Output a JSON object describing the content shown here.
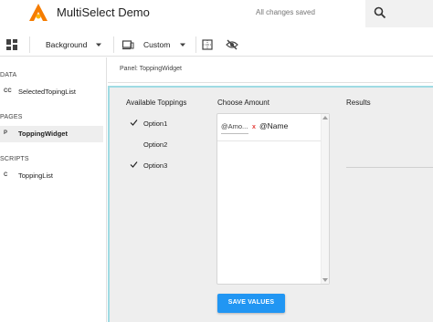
{
  "app": {
    "title": "MultiSelect Demo",
    "save_status": "All changes saved",
    "logo_icon": "wing-logo-icon",
    "search_icon": "search-icon"
  },
  "toolbar": {
    "layout_icon": "dashboard-icon",
    "background_label": "Background",
    "device_icon": "device-icon",
    "size_label": "Custom",
    "grid_icon": "grid-icon",
    "visibility_icon": "visibility-off-icon"
  },
  "sidebar": {
    "sections": [
      {
        "label": "DATA",
        "items": [
          {
            "kind": "CC",
            "label": "SelectedTopingList",
            "selected": false
          }
        ]
      },
      {
        "label": "PAGES",
        "items": [
          {
            "kind": "P",
            "label": "ToppingWidget",
            "selected": true
          }
        ]
      },
      {
        "label": "SCRIPTS",
        "items": [
          {
            "kind": "C",
            "label": "ToppingList",
            "selected": false
          }
        ]
      }
    ]
  },
  "breadcrumb": "Panel: ToppingWidget",
  "panel": {
    "available_heading": "Available Toppings",
    "amount_heading": "Choose Amount",
    "results_heading": "Results",
    "toppings": [
      {
        "label": "Option1",
        "checked": true
      },
      {
        "label": "Option2",
        "checked": false
      },
      {
        "label": "Option3",
        "checked": true
      }
    ],
    "amount_row": {
      "amount_value": "@Amo...",
      "remove_label": "x",
      "name_value": "@Name"
    },
    "save_button": "SAVE VALUES"
  },
  "colors": {
    "accent": "#2196f3",
    "selection_outline": "#9fdbe3",
    "remove": "#e53935",
    "logo_orange": "#f57c00"
  }
}
